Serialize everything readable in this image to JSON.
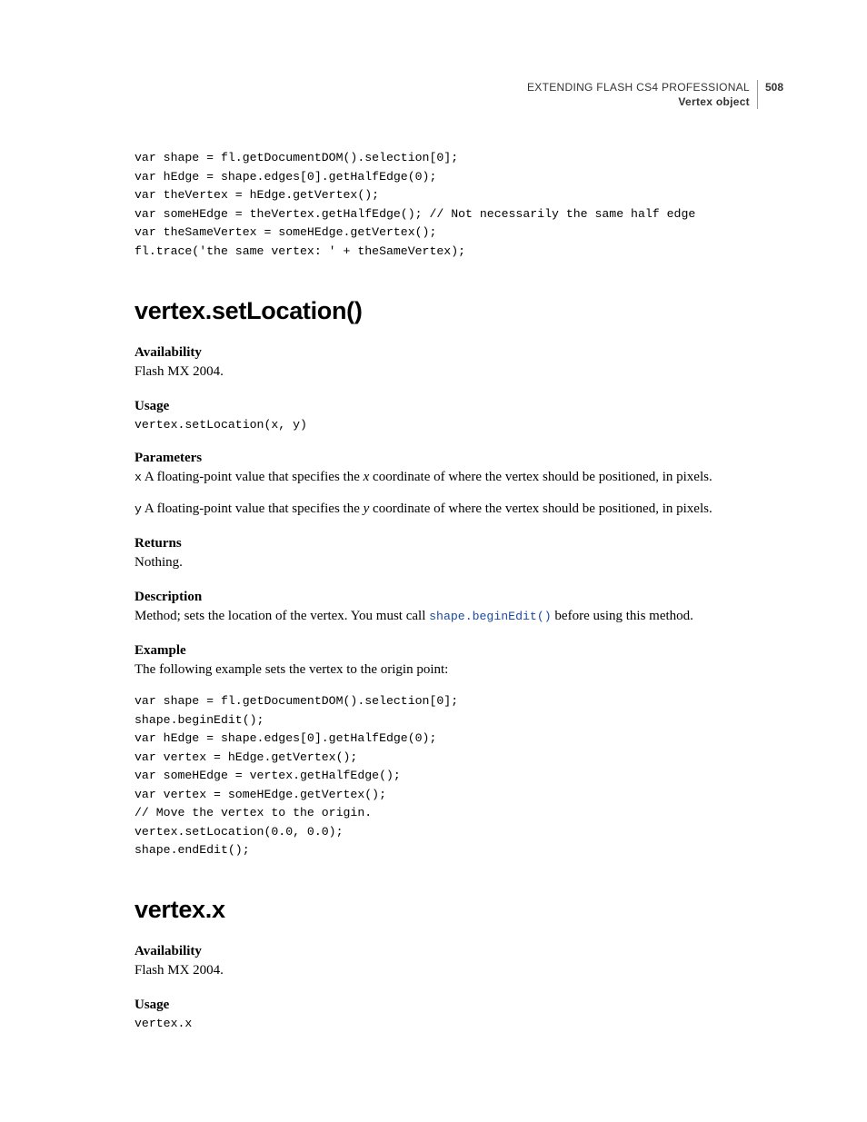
{
  "header": {
    "title": "EXTENDING FLASH CS4 PROFESSIONAL",
    "subtitle": "Vertex object",
    "page_number": "508"
  },
  "code_block_top": "var shape = fl.getDocumentDOM().selection[0];\nvar hEdge = shape.edges[0].getHalfEdge(0);\nvar theVertex = hEdge.getVertex();\nvar someHEdge = theVertex.getHalfEdge(); // Not necessarily the same half edge\nvar theSameVertex = someHEdge.getVertex();\nfl.trace('the same vertex: ' + theSameVertex);",
  "section1": {
    "heading": "vertex.setLocation()",
    "availability_label": "Availability",
    "availability_text": "Flash MX 2004.",
    "usage_label": "Usage",
    "usage_code": "vertex.setLocation(x, y)",
    "parameters_label": "Parameters",
    "param_x_code": "x",
    "param_x_text_a": "  A floating-point value that specifies the ",
    "param_x_italic": "x",
    "param_x_text_b": " coordinate of where the vertex should be positioned, in pixels.",
    "param_y_code": "y",
    "param_y_text_a": "  A floating-point value that specifies the ",
    "param_y_italic": "y",
    "param_y_text_b": " coordinate of where the vertex should be positioned, in pixels.",
    "returns_label": "Returns",
    "returns_text": "Nothing.",
    "description_label": "Description",
    "description_text_a": "Method; sets the location of the vertex. You must call ",
    "description_link": "shape.beginEdit()",
    "description_text_b": " before using this method.",
    "example_label": "Example",
    "example_intro": "The following example sets the vertex to the origin point:",
    "example_code": "var shape = fl.getDocumentDOM().selection[0];\nshape.beginEdit();\nvar hEdge = shape.edges[0].getHalfEdge(0);\nvar vertex = hEdge.getVertex();\nvar someHEdge = vertex.getHalfEdge();\nvar vertex = someHEdge.getVertex();\n// Move the vertex to the origin.\nvertex.setLocation(0.0, 0.0);\nshape.endEdit();"
  },
  "section2": {
    "heading": "vertex.x",
    "availability_label": "Availability",
    "availability_text": "Flash MX 2004.",
    "usage_label": "Usage",
    "usage_code": "vertex.x"
  }
}
